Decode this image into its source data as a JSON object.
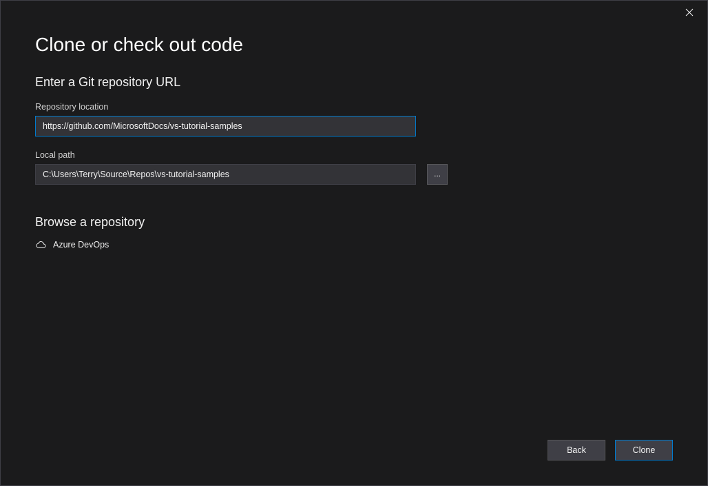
{
  "header": {
    "title": "Clone or check out code"
  },
  "section": {
    "heading": "Enter a Git repository URL",
    "repo_label": "Repository location",
    "repo_value": "https://github.com/MicrosoftDocs/vs-tutorial-samples",
    "local_path_label": "Local path",
    "local_path_value": "C:\\Users\\Terry\\Source\\Repos\\vs-tutorial-samples",
    "browse_button": "..."
  },
  "browse": {
    "heading": "Browse a repository",
    "providers": [
      {
        "label": "Azure DevOps"
      }
    ]
  },
  "footer": {
    "back_label": "Back",
    "clone_label": "Clone"
  }
}
